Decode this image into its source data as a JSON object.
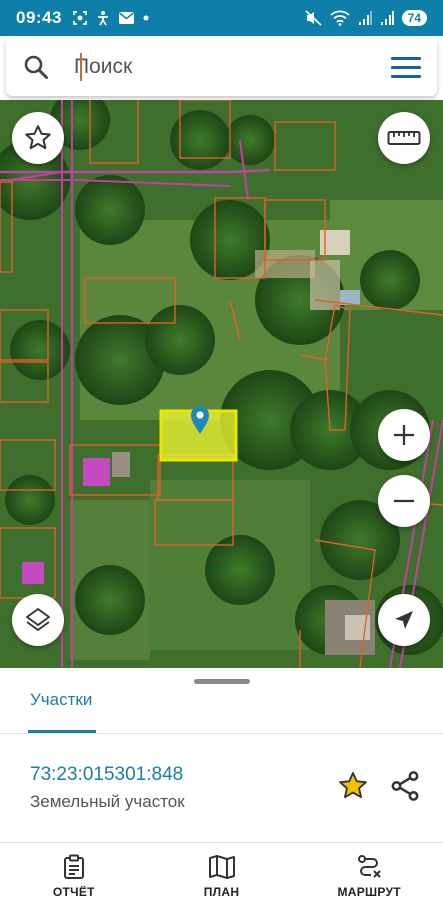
{
  "status_bar": {
    "time": "09:43",
    "battery": "74"
  },
  "search": {
    "placeholder": "Поиск",
    "value": ""
  },
  "map_controls": {
    "favorite_icon": "star-outline-icon",
    "ruler_icon": "ruler-icon",
    "zoom_in_icon": "plus-icon",
    "zoom_out_icon": "minus-icon",
    "layers_icon": "layers-icon",
    "locate_icon": "navigation-arrow-icon"
  },
  "sheet": {
    "tab_label": "Участки",
    "parcel": {
      "cadastral_number": "73:23:015301:848",
      "type": "Земельный участок"
    }
  },
  "bottom_nav": {
    "items": [
      {
        "label": "ОТЧЁТ",
        "icon": "report-icon"
      },
      {
        "label": "ПЛАН",
        "icon": "map-icon"
      },
      {
        "label": "МАРШРУТ",
        "icon": "route-icon"
      }
    ]
  },
  "colors": {
    "accent": "#1a7fa6",
    "status_bar": "#0d7fa8",
    "parcel_border": "#e0602a",
    "road_border": "#c23fa0",
    "selected_parcel": "#ffff33",
    "favorite_star": "#f2c200"
  }
}
